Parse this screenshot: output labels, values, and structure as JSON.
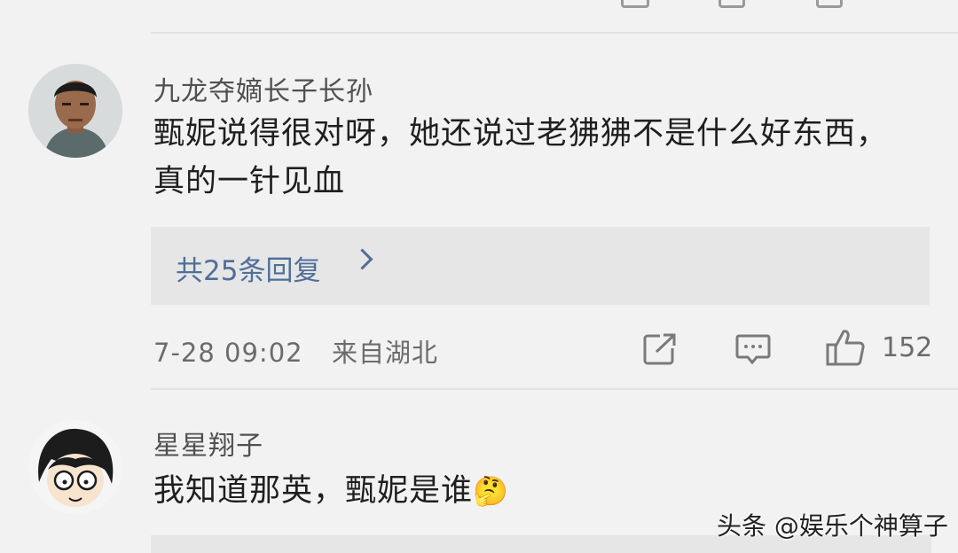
{
  "comments": [
    {
      "username": "九龙夺嫡长子长孙",
      "text": "甄妮说得很对呀，她还说过老狒狒不是什么好东西，真的一针见血",
      "replies_label": "共25条回复",
      "time": "7-28 09:02",
      "location": "来自湖北",
      "likes": "152"
    },
    {
      "username": "星星翔子",
      "text": "我知道那英，甄妮是谁",
      "emoji": "🤔"
    }
  ],
  "watermark": "头条 @娱乐个神算子",
  "icons": [
    "share-icon",
    "comment-icon",
    "like-icon",
    "chevron-right-icon"
  ]
}
